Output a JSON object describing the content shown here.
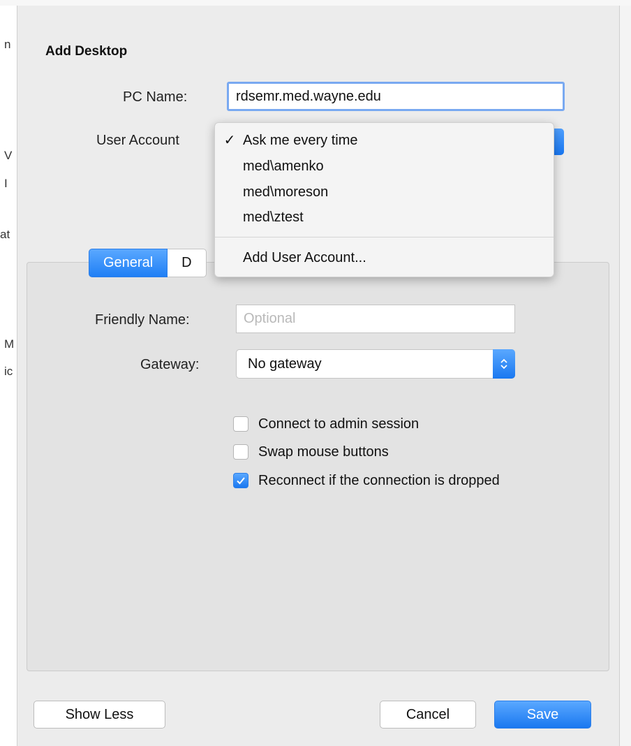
{
  "window": {
    "title": "Add Desktop"
  },
  "background": {
    "left_edge_chars": [
      "n",
      "V",
      "I",
      "at",
      "M",
      "ic"
    ]
  },
  "form": {
    "pc_name_label": "PC Name:",
    "pc_name_value": "rdsemr.med.wayne.edu",
    "user_account_label": "User Account"
  },
  "user_account_menu": {
    "items": [
      {
        "label": "Ask me every time",
        "checked": true,
        "check_glyph": "✓"
      },
      {
        "label": "med\\amenko",
        "checked": false
      },
      {
        "label": "med\\moreson",
        "checked": false
      },
      {
        "label": "med\\ztest",
        "checked": false
      }
    ],
    "add_label": "Add User Account..."
  },
  "tabs": [
    {
      "label": "General",
      "active": true
    },
    {
      "label": "D",
      "active": false
    }
  ],
  "general": {
    "friendly_name_label": "Friendly Name:",
    "friendly_name_placeholder": "Optional",
    "friendly_name_value": "",
    "gateway_label": "Gateway:",
    "gateway_value": "No gateway",
    "options": [
      {
        "label": "Connect to admin session",
        "checked": false
      },
      {
        "label": "Swap mouse buttons",
        "checked": false
      },
      {
        "label": "Reconnect if the connection is dropped",
        "checked": true
      }
    ]
  },
  "buttons": {
    "show_less": "Show Less",
    "cancel": "Cancel",
    "save": "Save"
  },
  "colors": {
    "accent": "#1a78f0",
    "focus_ring": "#79a9f1",
    "background": "#ececec",
    "panel": "#e3e3e3"
  },
  "icons": {
    "stepper": "up-down-chevron-icon",
    "checkbox_check": "checkmark-icon"
  }
}
